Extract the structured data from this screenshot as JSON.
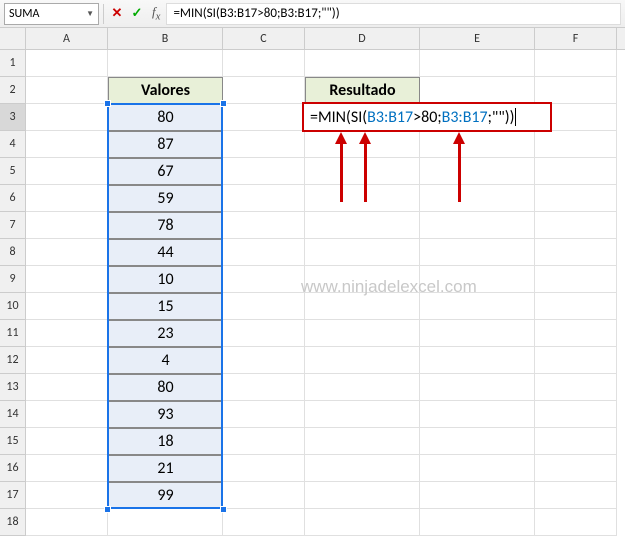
{
  "nameBox": "SUMA",
  "formulaBar": {
    "prefix": "=",
    "fn1": "MIN",
    "paren1": "(",
    "fn2": "SI",
    "paren2": "(",
    "ref1": "B3:B17",
    "op": ">",
    "num": "80",
    "sep1": ";",
    "ref2": "B3:B17",
    "sep2": ";",
    "str": "\"\"",
    "paren3": ")",
    "paren4": ")"
  },
  "columns": [
    "A",
    "B",
    "C",
    "D",
    "E",
    "F"
  ],
  "rowNumbers": [
    "1",
    "2",
    "3",
    "4",
    "5",
    "6",
    "7",
    "8",
    "9",
    "10",
    "11",
    "12",
    "13",
    "14",
    "15",
    "16",
    "17",
    "18"
  ],
  "activeRow": "3",
  "headers": {
    "valores": "Valores",
    "resultado": "Resultado"
  },
  "values": [
    "80",
    "87",
    "67",
    "59",
    "78",
    "44",
    "10",
    "15",
    "23",
    "4",
    "80",
    "93",
    "18",
    "21",
    "99"
  ],
  "watermark": "www.ninjadelexcel.com",
  "chart_data": {
    "type": "table",
    "title": "Valores",
    "categories": [
      "Row 3",
      "Row 4",
      "Row 5",
      "Row 6",
      "Row 7",
      "Row 8",
      "Row 9",
      "Row 10",
      "Row 11",
      "Row 12",
      "Row 13",
      "Row 14",
      "Row 15",
      "Row 16",
      "Row 17"
    ],
    "values": [
      80,
      87,
      67,
      59,
      78,
      44,
      10,
      15,
      23,
      4,
      80,
      93,
      18,
      21,
      99
    ]
  }
}
